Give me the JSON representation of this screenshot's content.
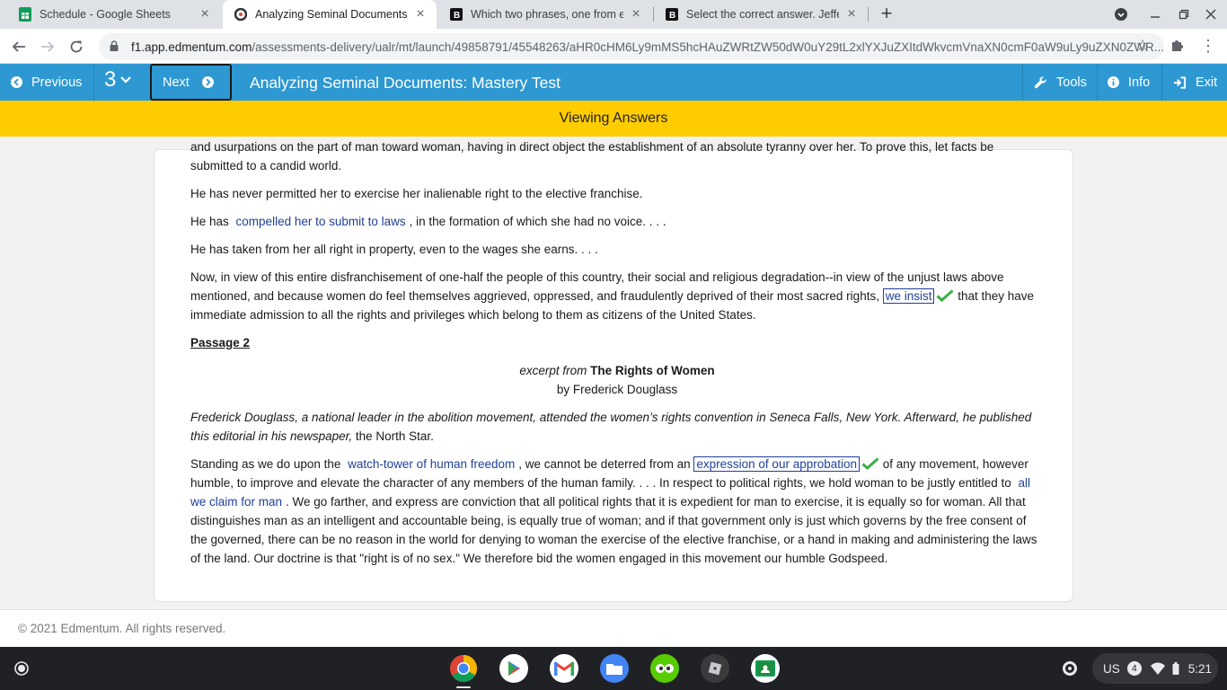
{
  "browser": {
    "tabs": [
      {
        "title": "Schedule - Google Sheets",
        "favicon": "google-sheets-icon",
        "active": false
      },
      {
        "title": "Analyzing Seminal Documents: M",
        "favicon": "edmentum-icon",
        "active": true
      },
      {
        "title": "Which two phrases, one from ea",
        "favicon": "brainly-icon",
        "active": false
      },
      {
        "title": "Select the correct answer. Jeffer",
        "favicon": "brainly-icon",
        "active": false
      }
    ],
    "url_host": "f1.app.edmentum.com",
    "url_path": "/assessments-delivery/ualr/mt/launch/49858791/45548263/aHR0cHM6Ly9mMS5hcHAuZWRtZW50dW0uY29tL2xlYXJuZXItdWkvcmVnaXN0cmF0aW9uLy9uZXN0ZWR..."
  },
  "appbar": {
    "previous_label": "Previous",
    "question_number": "3",
    "next_label": "Next",
    "title": "Analyzing Seminal Documents: Mastery Test",
    "tools_label": "Tools",
    "info_label": "Info",
    "exit_label": "Exit"
  },
  "banner": "Viewing Answers",
  "passage1": {
    "p0": "and usurpations on the part of man toward woman, having in direct object the establishment of an absolute tyranny over her. To prove this, let facts be submitted to a candid world.",
    "p1": "He has never permitted her to exercise her inalienable right to the elective franchise.",
    "p2_pre": "He has",
    "p2_ans": "compelled her to submit to laws",
    "p2_post": ", in the formation of which she had no voice. . . .",
    "p3": "He has taken from her all right in property, even to the wages she earns. . . .",
    "p4_pre": "Now, in view of this entire disfranchisement of one-half the people of this country, their social and religious degradation--in view of the unjust laws above mentioned, and because women do feel themselves aggrieved, oppressed, and fraudulently deprived of their most sacred rights,",
    "p4_ans": "we insist",
    "p4_post": "that they have immediate admission to all the rights and privileges which belong to them as citizens of the United States."
  },
  "passage2": {
    "heading": "Passage 2",
    "excerpt_from": "excerpt from",
    "work_title": "The Rights of Women",
    "byline": "by Frederick Douglass",
    "intro_italic": "Frederick Douglass, a national leader in the abolition movement, attended the women’s rights convention in Seneca Falls, New York. Afterward, he published this editorial in his newspaper,",
    "intro_plain": "the North Star.",
    "s_pre": "Standing as we do upon the",
    "s_ans1": "watch-tower of human freedom",
    "s_mid1": ", we cannot be deterred from an",
    "s_ans2": "expression of our approbation",
    "s_mid2": "of any movement, however humble, to improve and elevate the character of any members of the human family. . . . In respect to political rights, we hold woman to be justly entitled to",
    "s_ans3": "all we claim for man",
    "s_post": ". We go farther, and express are conviction that all political rights that it is expedient for man to exercise, it is equally so for woman. All that distinguishes man as an intelligent and accountable being, is equally true of woman; and if that government only is just which governs by the free consent of the governed, there can be no reason in the world for denying to woman the exercise of the elective franchise, or a hand in making and administering the laws of the land. Our doctrine is that \"right is of no sex.\" We therefore bid the women engaged in this movement our humble Godspeed."
  },
  "footer": "© 2021 Edmentum. All rights reserved.",
  "tray": {
    "keyboard": "US",
    "notifications": "4",
    "time": "5:21"
  },
  "colors": {
    "appbar": "#2d98d2",
    "banner": "#ffcc00",
    "answer": "#1f3f9a",
    "check": "#3cb043"
  }
}
